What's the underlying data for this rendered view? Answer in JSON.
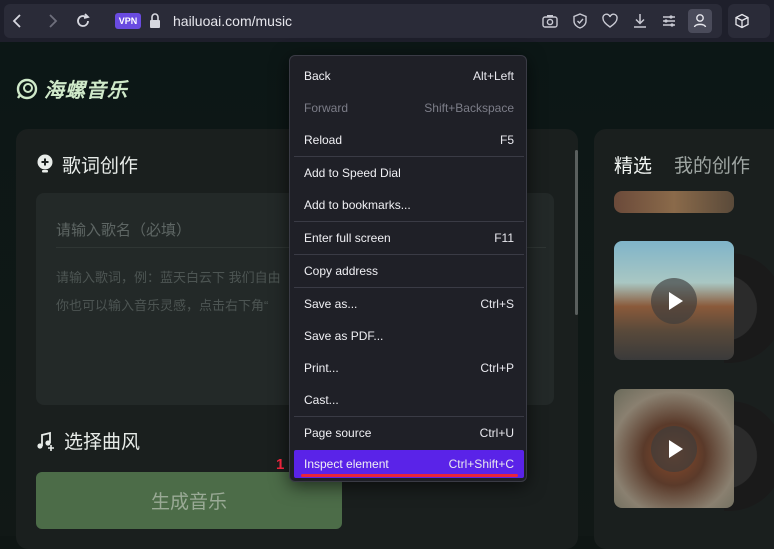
{
  "browser": {
    "url": "hailuoai.com/music",
    "vpn_label": "VPN"
  },
  "app": {
    "logo_text": "海螺音乐"
  },
  "lyrics": {
    "section_title": "歌词创作",
    "song_name_placeholder": "请输入歌名（必填）",
    "lyrics_hint_1": "请输入歌词，例：蓝天白云下 我们自由",
    "lyrics_hint_2": "你也可以输入音乐灵感，点击右下角“"
  },
  "style": {
    "section_title": "选择曲风",
    "generate_button": "生成音乐"
  },
  "right": {
    "tabs": [
      "精选",
      "我的创作"
    ]
  },
  "context_menu": {
    "items": [
      {
        "label": "Back",
        "shortcut": "Alt+Left"
      },
      {
        "label": "Forward",
        "shortcut": "Shift+Backspace"
      },
      {
        "label": "Reload",
        "shortcut": "F5"
      },
      {
        "label": "Add to Speed Dial",
        "shortcut": ""
      },
      {
        "label": "Add to bookmarks...",
        "shortcut": ""
      },
      {
        "label": "Enter full screen",
        "shortcut": "F11"
      },
      {
        "label": "Copy address",
        "shortcut": ""
      },
      {
        "label": "Save as...",
        "shortcut": "Ctrl+S"
      },
      {
        "label": "Save as PDF...",
        "shortcut": ""
      },
      {
        "label": "Print...",
        "shortcut": "Ctrl+P"
      },
      {
        "label": "Cast...",
        "shortcut": ""
      },
      {
        "label": "Page source",
        "shortcut": "Ctrl+U"
      },
      {
        "label": "Inspect element",
        "shortcut": "Ctrl+Shift+C"
      }
    ]
  },
  "annotation": {
    "marker": "1"
  },
  "colors": {
    "menu_highlight": "#5a23e8",
    "annotation_red": "#e8233b",
    "generate_button": "#4c6c48"
  }
}
